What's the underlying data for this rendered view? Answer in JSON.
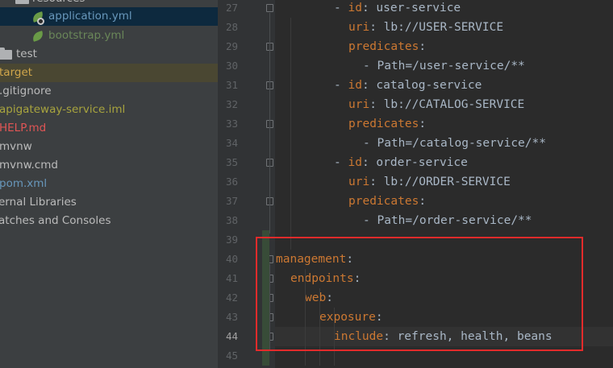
{
  "tree": {
    "items": [
      {
        "label": "resources",
        "type": "folder",
        "color": "#bbbbbb"
      },
      {
        "label": "application.yml",
        "type": "spring-config",
        "color": "#6897bb",
        "selected": true
      },
      {
        "label": "bootstrap.yml",
        "type": "spring-config",
        "color": "#6a8759"
      },
      {
        "label": "test",
        "type": "folder",
        "color": "#bbbbbb"
      },
      {
        "label": "target",
        "type": "folder",
        "color": "#d0a64b",
        "highlighted": true
      },
      {
        "label": ".gitignore",
        "type": "file",
        "color": "#bbbbbb"
      },
      {
        "label": "apigateway-service.iml",
        "type": "file",
        "color": "#a8a43e"
      },
      {
        "label": "HELP.md",
        "type": "file",
        "color": "#e05555"
      },
      {
        "label": "mvnw",
        "type": "file",
        "color": "#bbbbbb"
      },
      {
        "label": "mvnw.cmd",
        "type": "file",
        "color": "#bbbbbb"
      },
      {
        "label": "pom.xml",
        "type": "file",
        "color": "#6897bb"
      },
      {
        "label": "ernal Libraries",
        "type": "node",
        "color": "#bbbbbb"
      },
      {
        "label": "atches and Consoles",
        "type": "node",
        "color": "#bbbbbb"
      }
    ]
  },
  "editor": {
    "current_line": "44",
    "lines": [
      {
        "num": "27",
        "parts": [
          {
            "t": "- ",
            "c": "v"
          },
          {
            "t": "id",
            "c": "k"
          },
          {
            "t": ": user-service",
            "c": "v"
          }
        ]
      },
      {
        "num": "28",
        "parts": [
          {
            "t": "uri",
            "c": "k"
          },
          {
            "t": ": lb://USER-SERVICE",
            "c": "v"
          }
        ]
      },
      {
        "num": "29",
        "parts": [
          {
            "t": "predicates",
            "c": "k"
          },
          {
            "t": ":",
            "c": "v"
          }
        ]
      },
      {
        "num": "30",
        "parts": [
          {
            "t": "- Path=/user-service/**",
            "c": "v"
          }
        ]
      },
      {
        "num": "31",
        "parts": [
          {
            "t": "- ",
            "c": "v"
          },
          {
            "t": "id",
            "c": "k"
          },
          {
            "t": ": catalog-service",
            "c": "v"
          }
        ]
      },
      {
        "num": "32",
        "parts": [
          {
            "t": "uri",
            "c": "k"
          },
          {
            "t": ": lb://CATALOG-SERVICE",
            "c": "v"
          }
        ]
      },
      {
        "num": "33",
        "parts": [
          {
            "t": "predicates",
            "c": "k"
          },
          {
            "t": ":",
            "c": "v"
          }
        ]
      },
      {
        "num": "34",
        "parts": [
          {
            "t": "- Path=/catalog-service/**",
            "c": "v"
          }
        ]
      },
      {
        "num": "35",
        "parts": [
          {
            "t": "- ",
            "c": "v"
          },
          {
            "t": "id",
            "c": "k"
          },
          {
            "t": ": order-service",
            "c": "v"
          }
        ]
      },
      {
        "num": "36",
        "parts": [
          {
            "t": "uri",
            "c": "k"
          },
          {
            "t": ": lb://ORDER-SERVICE",
            "c": "v"
          }
        ]
      },
      {
        "num": "37",
        "parts": [
          {
            "t": "predicates",
            "c": "k"
          },
          {
            "t": ":",
            "c": "v"
          }
        ]
      },
      {
        "num": "38",
        "parts": [
          {
            "t": "- Path=/order-service/**",
            "c": "v"
          }
        ]
      },
      {
        "num": "39",
        "parts": []
      },
      {
        "num": "40",
        "parts": [
          {
            "t": "management",
            "c": "k"
          },
          {
            "t": ":",
            "c": "v"
          }
        ]
      },
      {
        "num": "41",
        "parts": [
          {
            "t": "endpoints",
            "c": "k"
          },
          {
            "t": ":",
            "c": "v"
          }
        ]
      },
      {
        "num": "42",
        "parts": [
          {
            "t": "web",
            "c": "k"
          },
          {
            "t": ":",
            "c": "v"
          }
        ]
      },
      {
        "num": "43",
        "parts": [
          {
            "t": "exposure",
            "c": "k"
          },
          {
            "t": ":",
            "c": "v"
          }
        ]
      },
      {
        "num": "44",
        "parts": [
          {
            "t": "include",
            "c": "k"
          },
          {
            "t": ": refresh, health, beans",
            "c": "v"
          }
        ]
      },
      {
        "num": "45",
        "parts": []
      }
    ]
  },
  "colors": {
    "key": "#cc7832",
    "value": "#a9b7c6",
    "annotation_box": "#e32b2b"
  }
}
